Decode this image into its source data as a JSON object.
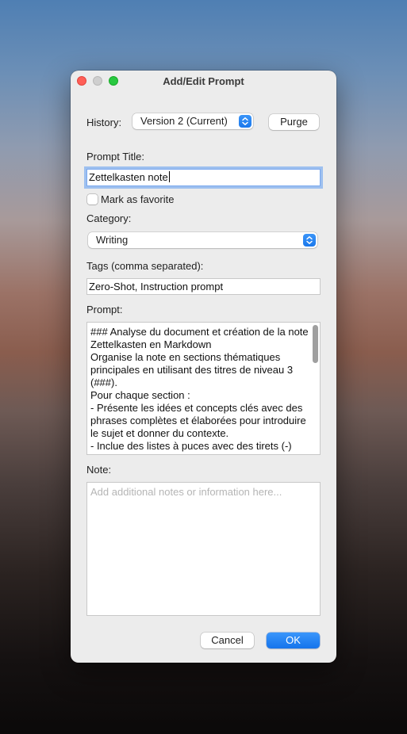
{
  "window": {
    "title": "Add/Edit Prompt"
  },
  "history": {
    "label": "History:",
    "selected": "Version 2 (Current)",
    "purge_label": "Purge"
  },
  "prompt_title": {
    "label": "Prompt Title:",
    "value": "Zettelkasten note"
  },
  "favorite": {
    "label": "Mark as favorite",
    "checked": false
  },
  "category": {
    "label": "Category:",
    "selected": "Writing"
  },
  "tags": {
    "label": "Tags (comma separated):",
    "value": "Zero-Shot, Instruction prompt"
  },
  "prompt": {
    "label": "Prompt:",
    "text": "### Analyse du document et création de la note Zettelkasten en Markdown\nOrganise la note en sections thématiques principales en utilisant des titres de niveau 3 (###).\nPour chaque section :\n- Présente les idées et concepts clés avec des phrases complètes et élaborées pour introduire le sujet et donner du contexte.\n- Inclue des listes à puces avec des tirets (-)"
  },
  "note": {
    "label": "Note:",
    "placeholder": "Add additional notes or information here..."
  },
  "buttons": {
    "cancel": "Cancel",
    "ok": "OK"
  },
  "colors": {
    "accent": "#1a78ec",
    "close": "#ff5f57",
    "maximize": "#28c840"
  }
}
